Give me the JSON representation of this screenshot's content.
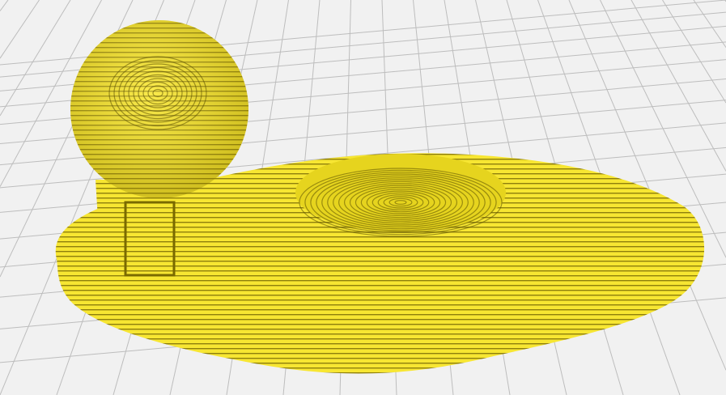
{
  "viewport": {
    "background": "#f1f1f1",
    "grid_color": "#bdbdbd",
    "model_color": "#f7e632",
    "layer_line_color": "#5a4e00"
  }
}
